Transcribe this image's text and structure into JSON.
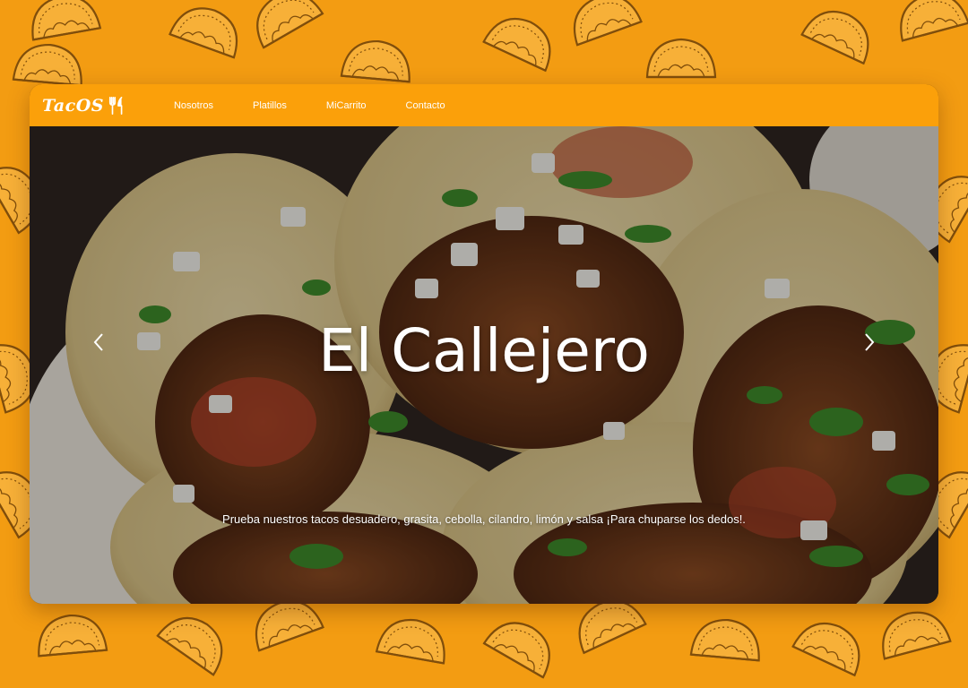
{
  "colors": {
    "background": "#f39c12",
    "navbar": "#fba00a",
    "text": "#ffffff"
  },
  "navbar": {
    "brand": "TacOS",
    "brand_icon": "fork-knife-icon",
    "links": [
      {
        "label": "Nosotros"
      },
      {
        "label": "Platillos"
      },
      {
        "label": "MiCarrito"
      },
      {
        "label": "Contacto"
      }
    ]
  },
  "carousel": {
    "title": "El Callejero",
    "caption": "Prueba nuestros tacos desuadero, grasita, cebolla, cilandro, limón y salsa ¡Para chuparse los dedos!.",
    "prev_icon": "chevron-left-icon",
    "next_icon": "chevron-right-icon"
  }
}
